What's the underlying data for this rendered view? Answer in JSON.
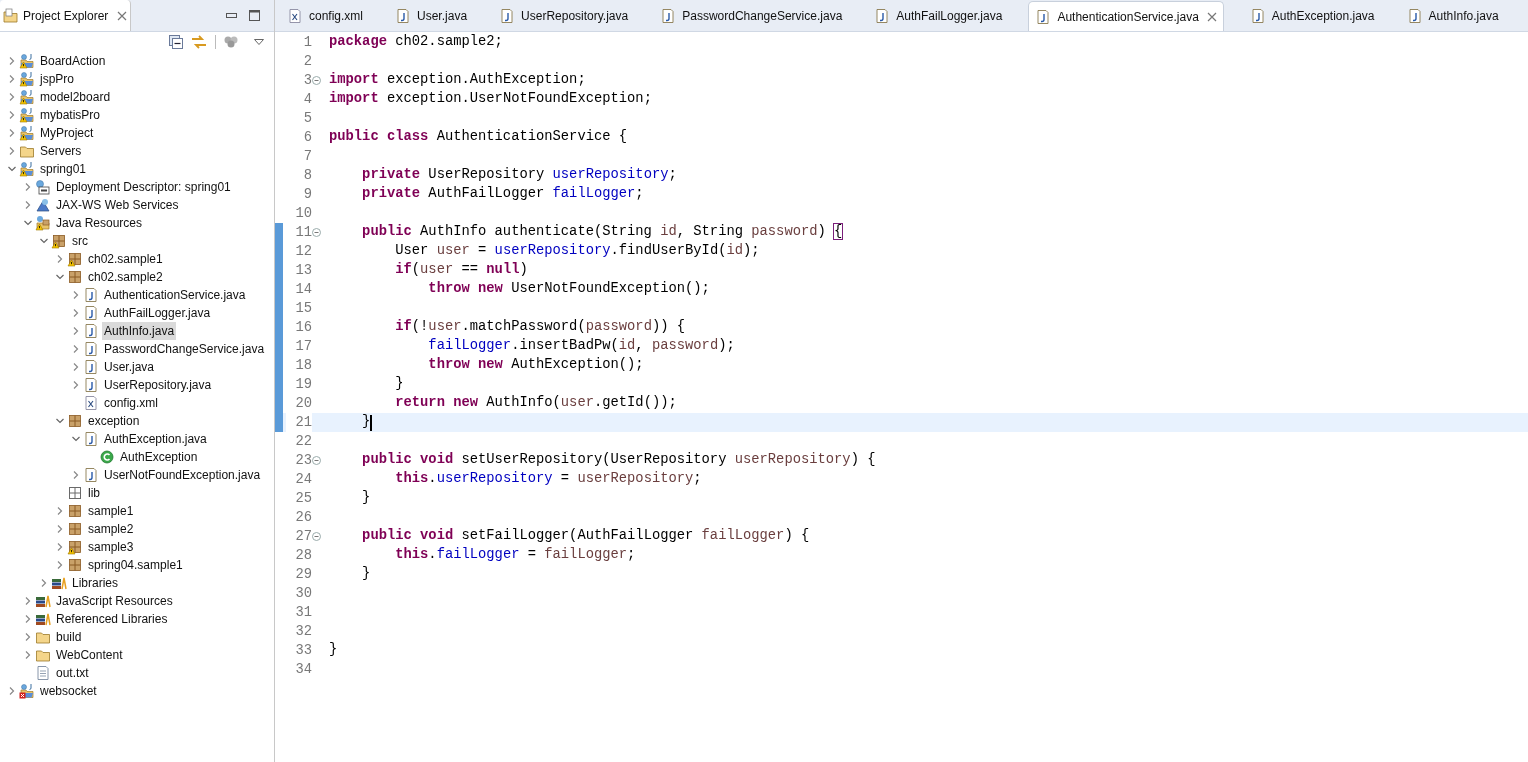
{
  "explorer": {
    "title": "Project Explorer",
    "tree": [
      {
        "label": "BoardAction",
        "kind": "project",
        "warning": true,
        "expanded": false,
        "selected": false
      },
      {
        "label": "jspPro",
        "kind": "project",
        "warning": true,
        "expanded": false,
        "selected": false
      },
      {
        "label": "model2board",
        "kind": "project",
        "warning": true,
        "expanded": false,
        "selected": false
      },
      {
        "label": "mybatisPro",
        "kind": "project",
        "warning": true,
        "expanded": false,
        "selected": false
      },
      {
        "label": "MyProject",
        "kind": "project",
        "warning": true,
        "expanded": false,
        "selected": false
      },
      {
        "label": "Servers",
        "kind": "folder",
        "warning": false,
        "expanded": false,
        "selected": false
      },
      {
        "label": "spring01",
        "kind": "project",
        "warning": true,
        "expanded": true,
        "selected": false,
        "children": [
          {
            "label": "Deployment Descriptor: spring01",
            "kind": "descriptor",
            "warning": false,
            "expanded": false,
            "selected": false
          },
          {
            "label": "JAX-WS Web Services",
            "kind": "webservice",
            "warning": false,
            "expanded": false,
            "selected": false
          },
          {
            "label": "Java Resources",
            "kind": "resources",
            "warning": true,
            "expanded": true,
            "selected": false,
            "children": [
              {
                "label": "src",
                "kind": "source",
                "warning": true,
                "expanded": true,
                "selected": false,
                "children": [
                  {
                    "label": "ch02.sample1",
                    "kind": "package",
                    "warning": true,
                    "expanded": false,
                    "selected": false
                  },
                  {
                    "label": "ch02.sample2",
                    "kind": "package",
                    "warning": false,
                    "expanded": true,
                    "selected": false,
                    "children": [
                      {
                        "label": "AuthenticationService.java",
                        "kind": "java",
                        "warning": false,
                        "expanded": false,
                        "selected": false
                      },
                      {
                        "label": "AuthFailLogger.java",
                        "kind": "java",
                        "warning": false,
                        "expanded": false,
                        "selected": false
                      },
                      {
                        "label": "AuthInfo.java",
                        "kind": "java",
                        "warning": false,
                        "expanded": false,
                        "selected": true
                      },
                      {
                        "label": "PasswordChangeService.java",
                        "kind": "java",
                        "warning": false,
                        "expanded": false,
                        "selected": false
                      },
                      {
                        "label": "User.java",
                        "kind": "java",
                        "warning": false,
                        "expanded": false,
                        "selected": false
                      },
                      {
                        "label": "UserRepository.java",
                        "kind": "java",
                        "warning": false,
                        "expanded": false,
                        "selected": false
                      },
                      {
                        "label": "config.xml",
                        "kind": "xml",
                        "warning": false,
                        "selected": false
                      }
                    ]
                  },
                  {
                    "label": "exception",
                    "kind": "package",
                    "warning": false,
                    "expanded": true,
                    "selected": false,
                    "children": [
                      {
                        "label": "AuthException.java",
                        "kind": "java",
                        "warning": false,
                        "expanded": true,
                        "selected": false,
                        "children": [
                          {
                            "label": "AuthException",
                            "kind": "class",
                            "warning": false,
                            "selected": false
                          }
                        ]
                      },
                      {
                        "label": "UserNotFoundException.java",
                        "kind": "java",
                        "warning": false,
                        "expanded": false,
                        "selected": false
                      }
                    ]
                  },
                  {
                    "label": "lib",
                    "kind": "empty-package",
                    "warning": false,
                    "selected": false
                  },
                  {
                    "label": "sample1",
                    "kind": "package",
                    "warning": false,
                    "expanded": false,
                    "selected": false
                  },
                  {
                    "label": "sample2",
                    "kind": "package",
                    "warning": false,
                    "expanded": false,
                    "selected": false
                  },
                  {
                    "label": "sample3",
                    "kind": "package",
                    "warning": true,
                    "expanded": false,
                    "selected": false
                  },
                  {
                    "label": "spring04.sample1",
                    "kind": "package",
                    "warning": false,
                    "expanded": false,
                    "selected": false
                  }
                ]
              },
              {
                "label": "Libraries",
                "kind": "library",
                "warning": false,
                "expanded": false,
                "selected": false
              }
            ]
          },
          {
            "label": "JavaScript Resources",
            "kind": "library",
            "warning": false,
            "expanded": false,
            "selected": false
          },
          {
            "label": "Referenced Libraries",
            "kind": "library",
            "warning": false,
            "expanded": false,
            "selected": false
          },
          {
            "label": "build",
            "kind": "folder",
            "warning": false,
            "expanded": false,
            "selected": false
          },
          {
            "label": "WebContent",
            "kind": "folder",
            "warning": false,
            "expanded": false,
            "selected": false
          },
          {
            "label": "out.txt",
            "kind": "text",
            "warning": false,
            "selected": false
          }
        ]
      },
      {
        "label": "websocket",
        "kind": "project",
        "warning": false,
        "error": true,
        "expanded": false,
        "selected": false
      }
    ]
  },
  "tabs": [
    {
      "label": "config.xml",
      "kind": "xml",
      "selected": false
    },
    {
      "label": "User.java",
      "kind": "java",
      "selected": false
    },
    {
      "label": "UserRepository.java",
      "kind": "java",
      "selected": false
    },
    {
      "label": "PasswordChangeService.java",
      "kind": "java",
      "selected": false
    },
    {
      "label": "AuthFailLogger.java",
      "kind": "java",
      "selected": false
    },
    {
      "label": "AuthenticationService.java",
      "kind": "java",
      "selected": true
    },
    {
      "label": "AuthException.java",
      "kind": "java",
      "selected": false
    },
    {
      "label": "AuthInfo.java",
      "kind": "java",
      "selected": false
    }
  ],
  "editor": {
    "lines": [
      {
        "number": "1",
        "fold": false,
        "changed": false,
        "current": false,
        "tokens": [
          {
            "kind": "keyword",
            "text": "package"
          },
          {
            "kind": "plain",
            "text": " ch02.sample2;"
          }
        ]
      },
      {
        "number": "2",
        "fold": false,
        "changed": false,
        "current": false
      },
      {
        "number": "3",
        "fold": true,
        "changed": false,
        "current": false,
        "tokens": [
          {
            "kind": "keyword",
            "text": "import"
          },
          {
            "kind": "plain",
            "text": " exception.AuthException;"
          }
        ]
      },
      {
        "number": "4",
        "fold": false,
        "changed": false,
        "current": false,
        "tokens": [
          {
            "kind": "keyword",
            "text": "import"
          },
          {
            "kind": "plain",
            "text": " exception.UserNotFoundException;"
          }
        ]
      },
      {
        "number": "5",
        "fold": false,
        "changed": false,
        "current": false
      },
      {
        "number": "6",
        "fold": false,
        "changed": false,
        "current": false,
        "tokens": [
          {
            "kind": "keyword",
            "text": "public class"
          },
          {
            "kind": "plain",
            "text": " AuthenticationService {"
          }
        ]
      },
      {
        "number": "7",
        "fold": false,
        "changed": false,
        "current": false
      },
      {
        "number": "8",
        "fold": false,
        "changed": false,
        "current": false,
        "tokens": [
          {
            "kind": "keyword",
            "text": "    private"
          },
          {
            "kind": "plain",
            "text": " UserRepository "
          },
          {
            "kind": "field",
            "text": "userRepository"
          },
          {
            "kind": "plain",
            "text": ";"
          }
        ]
      },
      {
        "number": "9",
        "fold": false,
        "changed": false,
        "current": false,
        "tokens": [
          {
            "kind": "keyword",
            "text": "    private"
          },
          {
            "kind": "plain",
            "text": " AuthFailLogger "
          },
          {
            "kind": "field",
            "text": "failLogger"
          },
          {
            "kind": "plain",
            "text": ";"
          }
        ]
      },
      {
        "number": "10",
        "fold": false,
        "changed": false,
        "current": false
      },
      {
        "number": "11",
        "fold": true,
        "changed": true,
        "current": false,
        "tokens": [
          {
            "kind": "keyword",
            "text": "    public"
          },
          {
            "kind": "plain",
            "text": " AuthInfo authenticate(String "
          },
          {
            "kind": "variable",
            "text": "id"
          },
          {
            "kind": "plain",
            "text": ", String "
          },
          {
            "kind": "variable",
            "text": "password"
          },
          {
            "kind": "plain",
            "text": ") "
          },
          {
            "kind": "bracket",
            "text": "{"
          }
        ]
      },
      {
        "number": "12",
        "fold": false,
        "changed": true,
        "current": false,
        "tokens": [
          {
            "kind": "plain",
            "text": "        User "
          },
          {
            "kind": "variable",
            "text": "user"
          },
          {
            "kind": "plain",
            "text": " = "
          },
          {
            "kind": "field",
            "text": "userRepository"
          },
          {
            "kind": "plain",
            "text": ".findUserById("
          },
          {
            "kind": "variable",
            "text": "id"
          },
          {
            "kind": "plain",
            "text": ");"
          }
        ]
      },
      {
        "number": "13",
        "fold": false,
        "changed": true,
        "current": false,
        "tokens": [
          {
            "kind": "keyword",
            "text": "        if"
          },
          {
            "kind": "plain",
            "text": "("
          },
          {
            "kind": "variable",
            "text": "user"
          },
          {
            "kind": "plain",
            "text": " == "
          },
          {
            "kind": "keyword",
            "text": "null"
          },
          {
            "kind": "plain",
            "text": ")"
          }
        ]
      },
      {
        "number": "14",
        "fold": false,
        "changed": true,
        "current": false,
        "tokens": [
          {
            "kind": "keyword",
            "text": "            throw new"
          },
          {
            "kind": "plain",
            "text": " UserNotFoundException();"
          }
        ]
      },
      {
        "number": "15",
        "fold": false,
        "changed": true,
        "current": false
      },
      {
        "number": "16",
        "fold": false,
        "changed": true,
        "current": false,
        "tokens": [
          {
            "kind": "keyword",
            "text": "        if"
          },
          {
            "kind": "plain",
            "text": "(!"
          },
          {
            "kind": "variable",
            "text": "user"
          },
          {
            "kind": "plain",
            "text": ".matchPassword("
          },
          {
            "kind": "variable",
            "text": "password"
          },
          {
            "kind": "plain",
            "text": ")) {"
          }
        ]
      },
      {
        "number": "17",
        "fold": false,
        "changed": true,
        "current": false,
        "tokens": [
          {
            "kind": "field",
            "text": "            failLogger"
          },
          {
            "kind": "plain",
            "text": ".insertBadPw("
          },
          {
            "kind": "variable",
            "text": "id"
          },
          {
            "kind": "plain",
            "text": ", "
          },
          {
            "kind": "variable",
            "text": "password"
          },
          {
            "kind": "plain",
            "text": ");"
          }
        ]
      },
      {
        "number": "18",
        "fold": false,
        "changed": true,
        "current": false,
        "tokens": [
          {
            "kind": "keyword",
            "text": "            throw new"
          },
          {
            "kind": "plain",
            "text": " AuthException();"
          }
        ]
      },
      {
        "number": "19",
        "fold": false,
        "changed": true,
        "current": false,
        "tokens": [
          {
            "kind": "plain",
            "text": "        }"
          }
        ]
      },
      {
        "number": "20",
        "fold": false,
        "changed": true,
        "current": false,
        "tokens": [
          {
            "kind": "keyword",
            "text": "        return new"
          },
          {
            "kind": "plain",
            "text": " AuthInfo("
          },
          {
            "kind": "variable",
            "text": "user"
          },
          {
            "kind": "plain",
            "text": ".getId());"
          }
        ]
      },
      {
        "number": "21",
        "fold": false,
        "changed": true,
        "current": true,
        "tokens": [
          {
            "kind": "plain",
            "text": "    }"
          }
        ]
      },
      {
        "number": "22",
        "fold": false,
        "changed": false,
        "current": false
      },
      {
        "number": "23",
        "fold": true,
        "changed": false,
        "current": false,
        "tokens": [
          {
            "kind": "keyword",
            "text": "    public void"
          },
          {
            "kind": "plain",
            "text": " setUserRepository(UserRepository "
          },
          {
            "kind": "variable",
            "text": "userRepository"
          },
          {
            "kind": "plain",
            "text": ") {"
          }
        ]
      },
      {
        "number": "24",
        "fold": false,
        "changed": false,
        "current": false,
        "tokens": [
          {
            "kind": "keyword",
            "text": "        this"
          },
          {
            "kind": "plain",
            "text": "."
          },
          {
            "kind": "field",
            "text": "userRepository"
          },
          {
            "kind": "plain",
            "text": " = "
          },
          {
            "kind": "variable",
            "text": "userRepository"
          },
          {
            "kind": "plain",
            "text": ";"
          }
        ]
      },
      {
        "number": "25",
        "fold": false,
        "changed": false,
        "current": false,
        "tokens": [
          {
            "kind": "plain",
            "text": "    }"
          }
        ]
      },
      {
        "number": "26",
        "fold": false,
        "changed": false,
        "current": false
      },
      {
        "number": "27",
        "fold": true,
        "changed": false,
        "current": false,
        "tokens": [
          {
            "kind": "keyword",
            "text": "    public void"
          },
          {
            "kind": "plain",
            "text": " setFailLogger(AuthFailLogger "
          },
          {
            "kind": "variable",
            "text": "failLogger"
          },
          {
            "kind": "plain",
            "text": ") {"
          }
        ]
      },
      {
        "number": "28",
        "fold": false,
        "changed": false,
        "current": false,
        "tokens": [
          {
            "kind": "keyword",
            "text": "        this"
          },
          {
            "kind": "plain",
            "text": "."
          },
          {
            "kind": "field",
            "text": "failLogger"
          },
          {
            "kind": "plain",
            "text": " = "
          },
          {
            "kind": "variable",
            "text": "failLogger"
          },
          {
            "kind": "plain",
            "text": ";"
          }
        ]
      },
      {
        "number": "29",
        "fold": false,
        "changed": false,
        "current": false,
        "tokens": [
          {
            "kind": "plain",
            "text": "    }"
          }
        ]
      },
      {
        "number": "30",
        "fold": false,
        "changed": false,
        "current": false
      },
      {
        "number": "31",
        "fold": false,
        "changed": false,
        "current": false
      },
      {
        "number": "32",
        "fold": false,
        "changed": false,
        "current": false
      },
      {
        "number": "33",
        "fold": false,
        "changed": false,
        "current": false,
        "tokens": [
          {
            "kind": "plain",
            "text": "}"
          }
        ]
      },
      {
        "number": "34",
        "fold": false,
        "changed": false,
        "current": false
      }
    ]
  }
}
